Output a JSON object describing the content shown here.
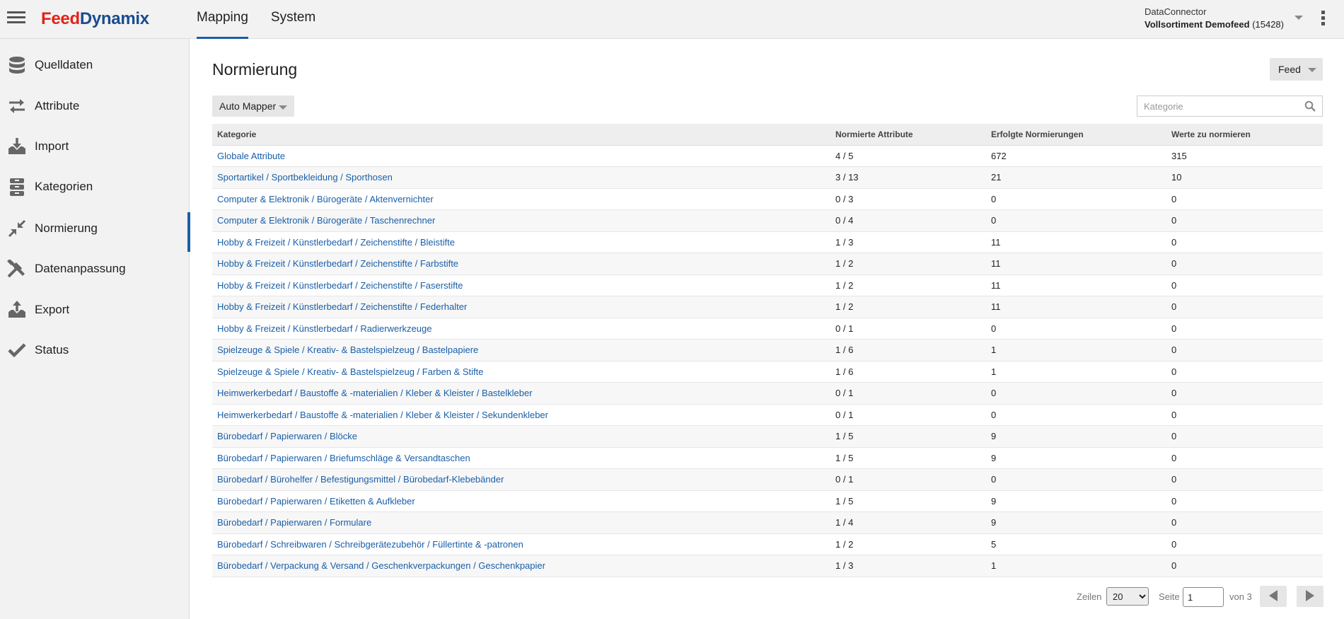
{
  "brand": {
    "part1": "Feed",
    "part2": "Dynamix"
  },
  "topnav": {
    "tabs": [
      {
        "label": "Mapping"
      },
      {
        "label": "System"
      }
    ]
  },
  "tenant": {
    "line1": "DataConnector",
    "feed_name": "Vollsortiment Demofeed",
    "feed_id": "(15428)"
  },
  "sidebar": {
    "items": [
      {
        "label": "Quelldaten",
        "icon": "database-icon"
      },
      {
        "label": "Attribute",
        "icon": "arrows-exchange-icon"
      },
      {
        "label": "Import",
        "icon": "import-tray-icon"
      },
      {
        "label": "Kategorien",
        "icon": "categories-icon"
      },
      {
        "label": "Normierung",
        "icon": "compress-arrows-icon"
      },
      {
        "label": "Datenanpassung",
        "icon": "tools-icon"
      },
      {
        "label": "Export",
        "icon": "export-tray-icon"
      },
      {
        "label": "Status",
        "icon": "checkmark-icon"
      }
    ]
  },
  "main": {
    "title": "Normierung",
    "feed_button": "Feed",
    "automapper_button": "Auto Mapper",
    "search_placeholder": "Kategorie",
    "table": {
      "headers": [
        "Kategorie",
        "Normierte Attribute",
        "Erfolgte Normierungen",
        "Werte zu normieren"
      ],
      "rows": [
        [
          "Globale Attribute",
          "4 / 5",
          "672",
          "315"
        ],
        [
          "Sportartikel / Sportbekleidung / Sporthosen",
          "3 / 13",
          "21",
          "10"
        ],
        [
          "Computer & Elektronik / Bürogeräte / Aktenvernichter",
          "0 / 3",
          "0",
          "0"
        ],
        [
          "Computer & Elektronik / Bürogeräte / Taschenrechner",
          "0 / 4",
          "0",
          "0"
        ],
        [
          "Hobby & Freizeit / Künstlerbedarf / Zeichenstifte / Bleistifte",
          "1 / 3",
          "11",
          "0"
        ],
        [
          "Hobby & Freizeit / Künstlerbedarf / Zeichenstifte / Farbstifte",
          "1 / 2",
          "11",
          "0"
        ],
        [
          "Hobby & Freizeit / Künstlerbedarf / Zeichenstifte / Faserstifte",
          "1 / 2",
          "11",
          "0"
        ],
        [
          "Hobby & Freizeit / Künstlerbedarf / Zeichenstifte / Federhalter",
          "1 / 2",
          "11",
          "0"
        ],
        [
          "Hobby & Freizeit / Künstlerbedarf / Radierwerkzeuge",
          "0 / 1",
          "0",
          "0"
        ],
        [
          "Spielzeuge & Spiele / Kreativ- & Bastelspielzeug / Bastelpapiere",
          "1 / 6",
          "1",
          "0"
        ],
        [
          "Spielzeuge & Spiele / Kreativ- & Bastelspielzeug / Farben & Stifte",
          "1 / 6",
          "1",
          "0"
        ],
        [
          "Heimwerkerbedarf / Baustoffe & -materialien / Kleber & Kleister / Bastelkleber",
          "0 / 1",
          "0",
          "0"
        ],
        [
          "Heimwerkerbedarf / Baustoffe & -materialien / Kleber & Kleister / Sekundenkleber",
          "0 / 1",
          "0",
          "0"
        ],
        [
          "Bürobedarf / Papierwaren / Blöcke",
          "1 / 5",
          "9",
          "0"
        ],
        [
          "Bürobedarf / Papierwaren / Briefumschläge & Versandtaschen",
          "1 / 5",
          "9",
          "0"
        ],
        [
          "Bürobedarf / Bürohelfer / Befestigungsmittel / Bürobedarf-Klebebänder",
          "0 / 1",
          "0",
          "0"
        ],
        [
          "Bürobedarf / Papierwaren / Etiketten & Aufkleber",
          "1 / 5",
          "9",
          "0"
        ],
        [
          "Bürobedarf / Papierwaren / Formulare",
          "1 / 4",
          "9",
          "0"
        ],
        [
          "Bürobedarf / Schreibwaren / Schreibgerätezubehör / Füllertinte & -patronen",
          "1 / 2",
          "5",
          "0"
        ],
        [
          "Bürobedarf / Verpackung & Versand / Geschenkverpackungen / Geschenkpapier",
          "1 / 3",
          "1",
          "0"
        ]
      ]
    },
    "pager": {
      "rows_label": "Zeilen",
      "rows_value": "20",
      "page_label": "Seite",
      "page_value": "1",
      "of_label": "von 3"
    }
  },
  "colors": {
    "accent": "#1a5fa8",
    "brand_red": "#e2231a",
    "brand_blue": "#1a4c8f"
  }
}
